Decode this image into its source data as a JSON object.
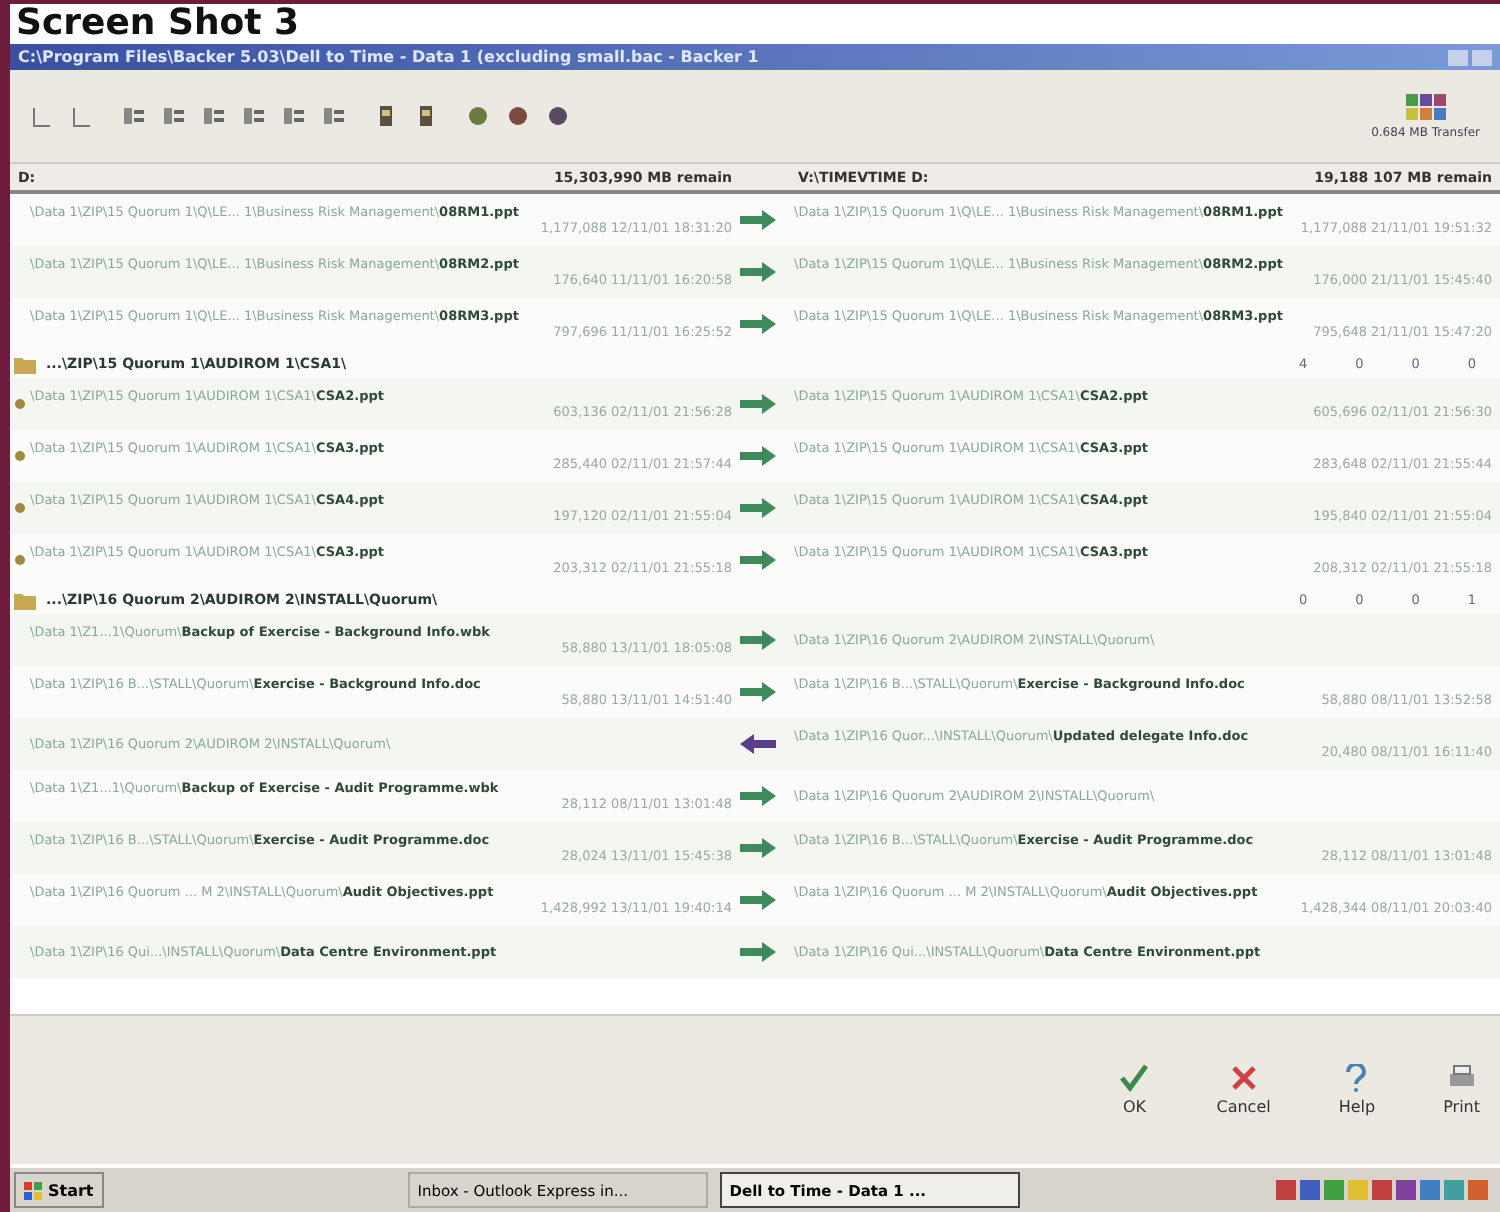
{
  "heading": "Screen Shot 3",
  "window": {
    "title": "C:\\Program Files\\Backer 5.03\\Dell to Time - Data 1 (excluding small.bac - Backer 1"
  },
  "toolbar": {
    "transfer": "0.684 MB Transfer"
  },
  "columns": [
    {
      "drive": "D:",
      "remain": "15,303,990 MB remain"
    },
    {
      "drive": "V:\\TIMEVTIME D:",
      "remain": "19,188 107 MB remain"
    }
  ],
  "rows": [
    {
      "kind": "file",
      "marked": false,
      "arrow": {
        "kind": "right"
      },
      "left": {
        "path": "\\Data 1\\ZIP\\15 Quorum 1\\Q\\LE... 1\\Business Risk Management\\**08RM1.ppt**",
        "info": "1,177,088 12/11/01 18:31:20"
      },
      "right": {
        "path": "\\Data 1\\ZIP\\15 Quorum 1\\Q\\LE... 1\\Business Risk Management\\**08RM1.ppt**",
        "info": "1,177,088 21/11/01 19:51:32"
      }
    },
    {
      "kind": "file",
      "marked": false,
      "arrow": {
        "kind": "right"
      },
      "left": {
        "path": "\\Data 1\\ZIP\\15 Quorum 1\\Q\\LE... 1\\Business Risk Management\\**08RM2.ppt**",
        "info": "176,640 11/11/01 16:20:58"
      },
      "right": {
        "path": "\\Data 1\\ZIP\\15 Quorum 1\\Q\\LE... 1\\Business Risk Management\\**08RM2.ppt**",
        "info": "176,000 21/11/01 15:45:40"
      }
    },
    {
      "kind": "file",
      "marked": false,
      "arrow": {
        "kind": "right"
      },
      "left": {
        "path": "\\Data 1\\ZIP\\15 Quorum 1\\Q\\LE... 1\\Business Risk Management\\**08RM3.ppt**",
        "info": "797,696 11/11/01 16:25:52"
      },
      "right": {
        "path": "\\Data 1\\ZIP\\15 Quorum 1\\Q\\LE... 1\\Business Risk Management\\**08RM3.ppt**",
        "info": "795,648 21/11/01 15:47:20"
      }
    },
    {
      "kind": "folder",
      "path": "...\\ZIP\\15 Quorum 1\\AUDIROM 1\\CSA1\\",
      "counts": [
        "4",
        "0",
        "0",
        "0"
      ]
    },
    {
      "kind": "file",
      "marked": true,
      "arrow": {
        "kind": "right"
      },
      "left": {
        "path": "\\Data 1\\ZIP\\15 Quorum 1\\AUDIROM 1\\CSA1\\**CSA2.ppt**",
        "info": "603,136 02/11/01 21:56:28"
      },
      "right": {
        "path": "\\Data 1\\ZIP\\15 Quorum 1\\AUDIROM 1\\CSA1\\**CSA2.ppt**",
        "info": "605,696 02/11/01 21:56:30"
      }
    },
    {
      "kind": "file",
      "marked": true,
      "arrow": {
        "kind": "right"
      },
      "left": {
        "path": "\\Data 1\\ZIP\\15 Quorum 1\\AUDIROM 1\\CSA1\\**CSA3.ppt**",
        "info": "285,440 02/11/01 21:57:44"
      },
      "right": {
        "path": "\\Data 1\\ZIP\\15 Quorum 1\\AUDIROM 1\\CSA1\\**CSA3.ppt**",
        "info": "283,648 02/11/01 21:55:44"
      }
    },
    {
      "kind": "file",
      "marked": true,
      "arrow": {
        "kind": "right"
      },
      "left": {
        "path": "\\Data 1\\ZIP\\15 Quorum 1\\AUDIROM 1\\CSA1\\**CSA4.ppt**",
        "info": "197,120 02/11/01 21:55:04"
      },
      "right": {
        "path": "\\Data 1\\ZIP\\15 Quorum 1\\AUDIROM 1\\CSA1\\**CSA4.ppt**",
        "info": "195,840 02/11/01 21:55:04"
      }
    },
    {
      "kind": "file",
      "marked": true,
      "arrow": {
        "kind": "right"
      },
      "left": {
        "path": "\\Data 1\\ZIP\\15 Quorum 1\\AUDIROM 1\\CSA1\\**CSA3.ppt**",
        "info": "203,312 02/11/01 21:55:18"
      },
      "right": {
        "path": "\\Data 1\\ZIP\\15 Quorum 1\\AUDIROM 1\\CSA1\\**CSA3.ppt**",
        "info": "208,312 02/11/01 21:55:18"
      }
    },
    {
      "kind": "folder",
      "path": "...\\ZIP\\16 Quorum 2\\AUDIROM 2\\INSTALL\\Quorum\\",
      "counts": [
        "0",
        "0",
        "0",
        "1"
      ]
    },
    {
      "kind": "file",
      "marked": false,
      "arrow": {
        "kind": "right"
      },
      "left": {
        "path": "\\Data 1\\Z1...1\\Quorum\\**Backup of Exercise - Background Info.wbk**",
        "info": "58,880 13/11/01 18:05:08"
      },
      "right": {
        "path": "\\Data 1\\ZIP\\16 Quorum 2\\AUDIROM 2\\INSTALL\\Quorum\\"
      }
    },
    {
      "kind": "file",
      "marked": false,
      "arrow": {
        "kind": "right"
      },
      "left": {
        "path": "\\Data 1\\ZIP\\16 B...\\STALL\\Quorum\\**Exercise - Background Info.doc**",
        "info": "58,880 13/11/01 14:51:40"
      },
      "right": {
        "path": "\\Data 1\\ZIP\\16 B...\\STALL\\Quorum\\**Exercise - Background Info.doc**",
        "info": "58,880 08/11/01 13:52:58"
      }
    },
    {
      "kind": "file",
      "marked": false,
      "arrow": {
        "kind": "left"
      },
      "left": {
        "path": "\\Data 1\\ZIP\\16 Quorum 2\\AUDIROM 2\\INSTALL\\Quorum\\"
      },
      "right": {
        "path": "\\Data 1\\ZIP\\16 Quor...\\INSTALL\\Quorum\\**Updated delegate Info.doc**",
        "info": "20,480 08/11/01 16:11:40"
      }
    },
    {
      "kind": "file",
      "marked": false,
      "arrow": {
        "kind": "right"
      },
      "left": {
        "path": "\\Data 1\\Z1...1\\Quorum\\**Backup of Exercise - Audit Programme.wbk**",
        "info": "28,112 08/11/01 13:01:48"
      },
      "right": {
        "path": "\\Data 1\\ZIP\\16 Quorum 2\\AUDIROM 2\\INSTALL\\Quorum\\"
      }
    },
    {
      "kind": "file",
      "marked": false,
      "arrow": {
        "kind": "right"
      },
      "left": {
        "path": "\\Data 1\\ZIP\\16 B...\\STALL\\Quorum\\**Exercise - Audit Programme.doc**",
        "info": "28,024 13/11/01 15:45:38"
      },
      "right": {
        "path": "\\Data 1\\ZIP\\16 B...\\STALL\\Quorum\\**Exercise - Audit Programme.doc**",
        "info": "28,112 08/11/01 13:01:48"
      }
    },
    {
      "kind": "file",
      "marked": false,
      "arrow": {
        "kind": "right"
      },
      "left": {
        "path": "\\Data 1\\ZIP\\16 Quorum ... M 2\\INSTALL\\Quorum\\**Audit Objectives.ppt**",
        "info": "1,428,992 13/11/01 19:40:14"
      },
      "right": {
        "path": "\\Data 1\\ZIP\\16 Quorum ... M 2\\INSTALL\\Quorum\\**Audit Objectives.ppt**",
        "info": "1,428,344 08/11/01 20:03:40"
      }
    },
    {
      "kind": "file",
      "marked": false,
      "arrow": {
        "kind": "right"
      },
      "left": {
        "path": "\\Data 1\\ZIP\\16 Qui...\\INSTALL\\Quorum\\**Data Centre Environment.ppt**"
      },
      "right": {
        "path": "\\Data 1\\ZIP\\16 Qui...\\INSTALL\\Quorum\\**Data Centre Environment.ppt**"
      }
    }
  ],
  "buttons": [
    {
      "kind": "ok",
      "label": "OK"
    },
    {
      "kind": "cancel",
      "label": "Cancel"
    },
    {
      "kind": "help",
      "label": "Help"
    },
    {
      "kind": "print",
      "label": "Print"
    }
  ],
  "taskbar": {
    "start": "Start",
    "tasks": [
      {
        "label": "Inbox - Outlook Express in...",
        "selected": false
      },
      {
        "label": "Dell to Time - Data 1 ...",
        "selected": true
      }
    ]
  }
}
